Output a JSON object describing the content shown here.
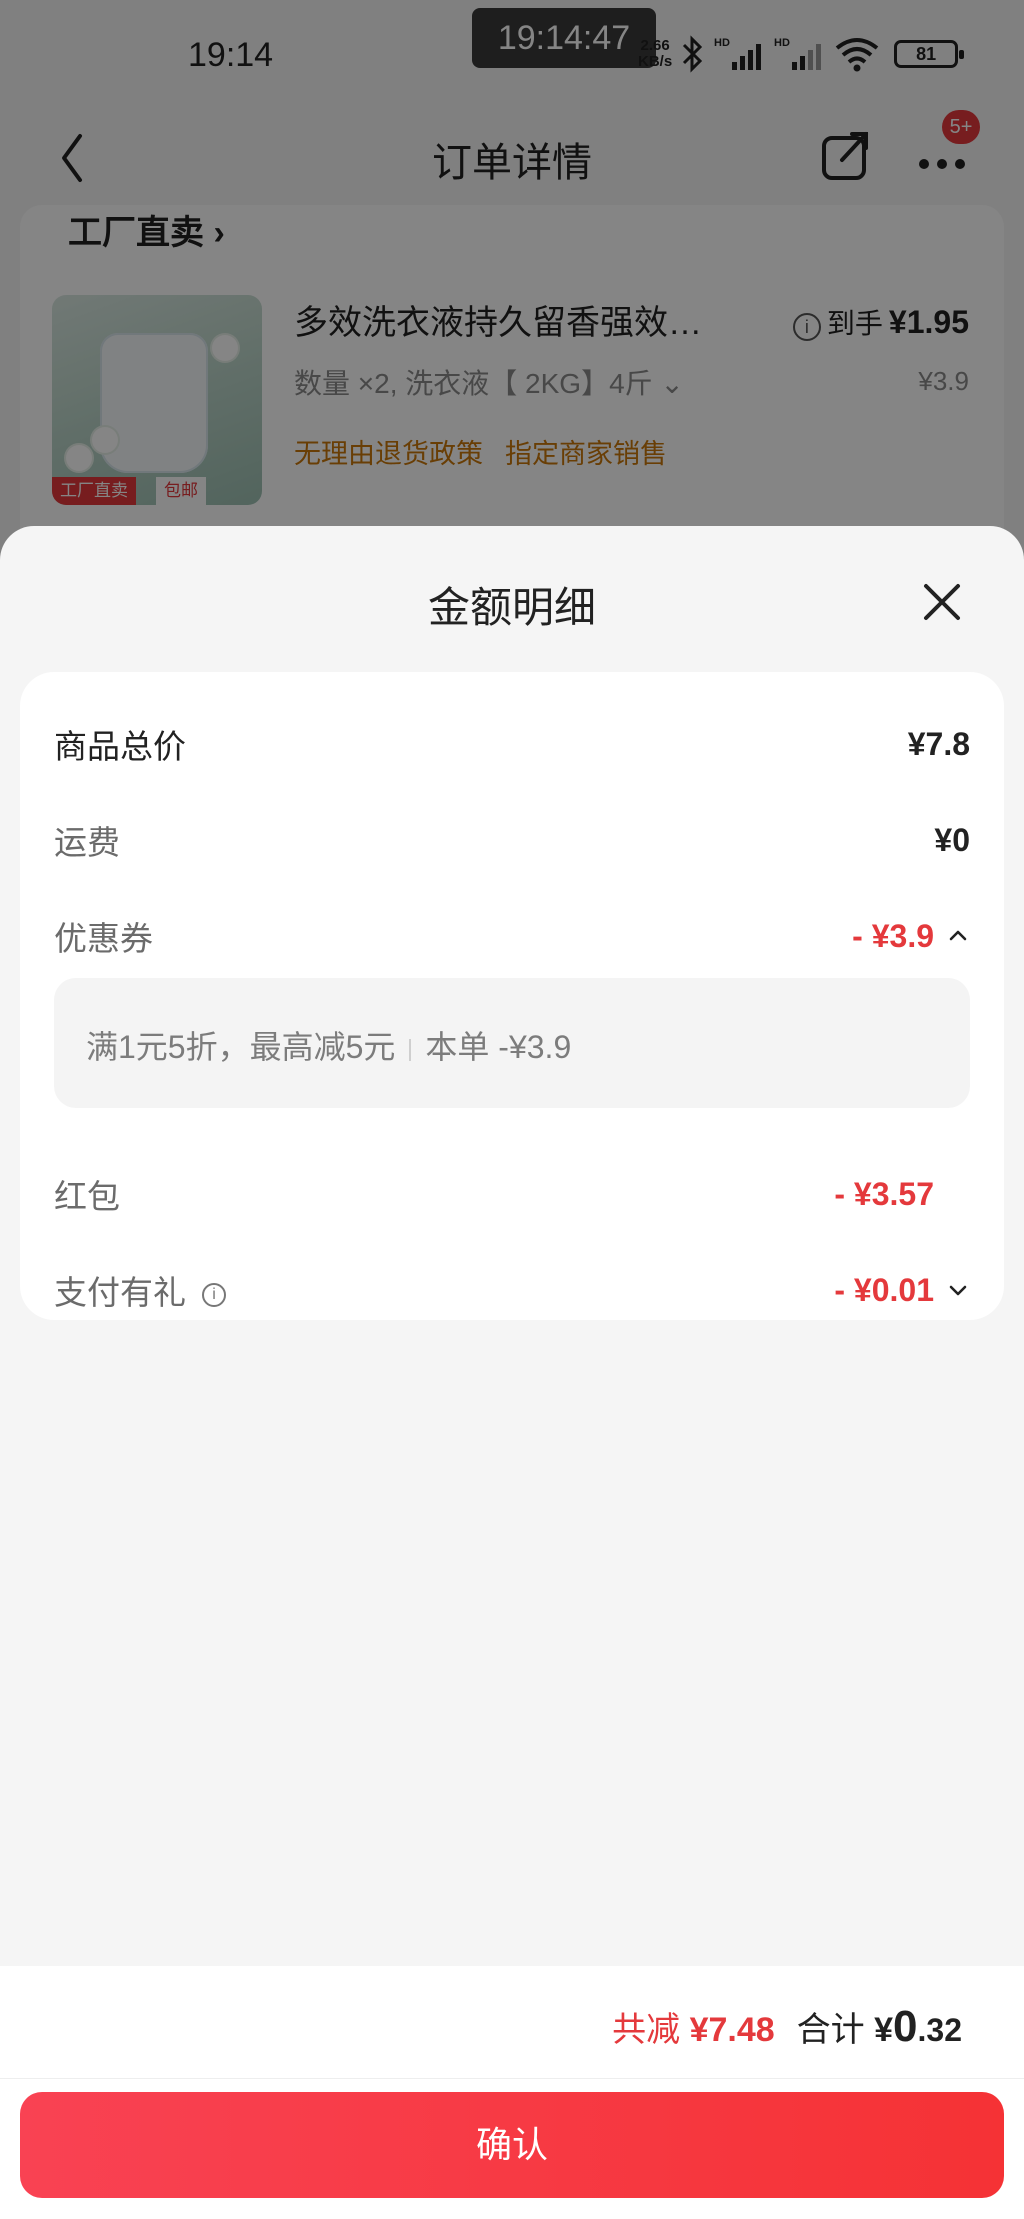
{
  "status_bar": {
    "time": "19:14",
    "clock_pill": "19:14:47",
    "net_speed_value": "2.66",
    "net_speed_unit": "KB/s",
    "battery": "81"
  },
  "nav": {
    "title": "订单详情",
    "badge": "5+"
  },
  "order": {
    "shop_name": "工厂直卖",
    "product_title": "多效洗衣液持久留香强效…",
    "spec": "数量 ×2, 洗衣液【 2KG】4斤",
    "policy_1": "无理由退货政策",
    "policy_2": "指定商家销售",
    "price_prefix": "到手",
    "price_value": "¥1.95",
    "original_price": "¥3.9",
    "tag_factory": "工厂直卖",
    "tag_ship": "包邮"
  },
  "sheet": {
    "title": "金额明细",
    "rows": [
      {
        "label": "商品总价",
        "value": "¥7.8"
      },
      {
        "label": "运费",
        "value": "¥0"
      },
      {
        "label": "优惠券",
        "value": "- ¥3.9"
      },
      {
        "label": "红包",
        "value": "- ¥3.57"
      },
      {
        "label": "支付有礼",
        "value": "- ¥0.01"
      }
    ],
    "coupon_detail": {
      "rule": "满1元5折，最高减5元",
      "applied": "本单 -¥3.9"
    }
  },
  "footer": {
    "reduce_label": "共减",
    "reduce_value": "¥7.48",
    "sum_label": "合计",
    "sum_currency": "¥",
    "sum_int": "0",
    "sum_dec": ".32",
    "confirm": "确认"
  },
  "colors": {
    "accent_red": "#e4393c",
    "policy_orange": "#c9780a"
  }
}
